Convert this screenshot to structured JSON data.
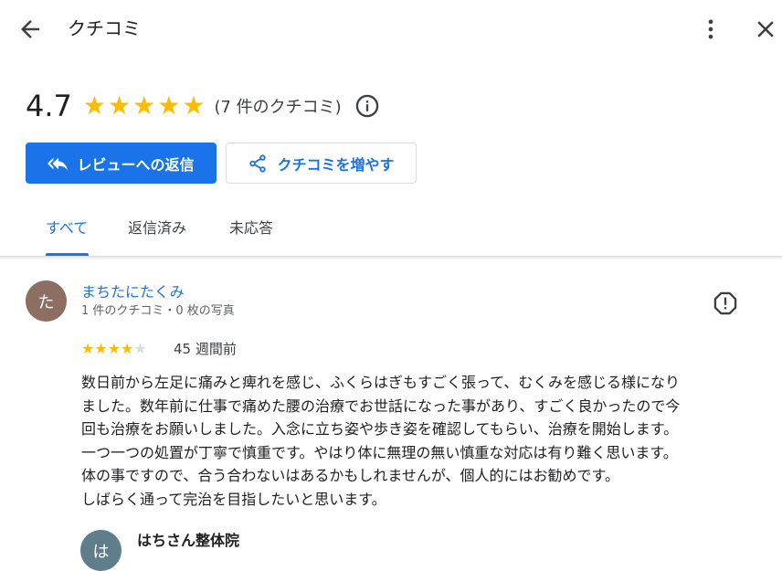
{
  "header": {
    "title": "クチコミ",
    "back_icon": "arrow-left-icon",
    "more_icon": "more-vertical-icon",
    "close_icon": "close-icon"
  },
  "summary": {
    "rating": "4.7",
    "stars": 5,
    "review_count": "(7 件のクチコミ)",
    "info_icon": "info-icon"
  },
  "actions": {
    "reply_label": "レビューへの返信",
    "share_label": "クチコミを増やす"
  },
  "tabs": [
    {
      "label": "すべて",
      "active": true
    },
    {
      "label": "返信済み",
      "active": false
    },
    {
      "label": "未応答",
      "active": false
    }
  ],
  "review": {
    "avatar_letter": "た",
    "name": "まちたにたくみ",
    "meta": "1 件のクチコミ・0 枚の写真",
    "rating": 4,
    "time": "45 週間前",
    "lines": [
      "数日前から左足に痛みと痺れを感じ、ふくらはぎもすごく張って、むくみを感じる様になり",
      "ました。数年前に仕事で痛めた腰の治療でお世話になった事があり、すごく良かったので今",
      "回も治療をお願いしました。入念に立ち姿や歩き姿を確認してもらい、治療を開始します。",
      "一つ一つの処置が丁寧で慎重です。やはり体に無理の無い慎重な対応は有り難く思います。",
      "体の事ですので、合う合わないはあるかもしれませんが、個人的にはお勧めです。",
      "しばらく通って完治を目指したいと思います。"
    ]
  },
  "reply": {
    "avatar_letter": "は",
    "name": "はちさん整体院"
  },
  "colors": {
    "accent": "#1a73e8",
    "star": "#fbbc04",
    "avatar": "#8d6e63"
  }
}
